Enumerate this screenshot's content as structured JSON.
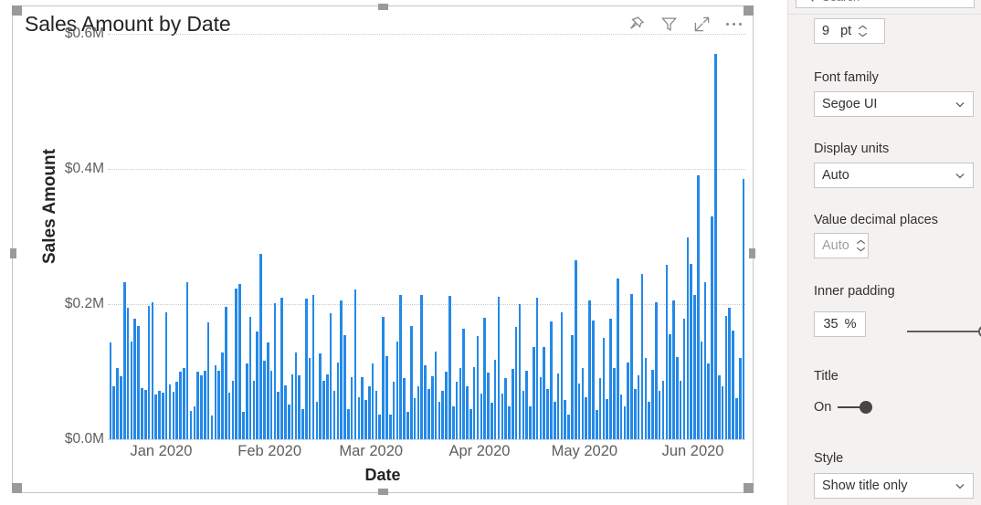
{
  "visual": {
    "title": "Sales Amount by Date",
    "header_icons": [
      {
        "name": "pin-icon",
        "label": "Pin to dashboard"
      },
      {
        "name": "filter-icon",
        "label": "Filters"
      },
      {
        "name": "focus-mode-icon",
        "label": "Focus mode"
      },
      {
        "name": "more-options-icon",
        "label": "More options"
      }
    ],
    "selected": true
  },
  "chart_data": {
    "type": "bar",
    "title": "Sales Amount by Date",
    "xlabel": "Date",
    "ylabel": "Sales Amount",
    "grid": true,
    "legend": "none",
    "ylim": [
      0,
      0.6
    ],
    "ytick_labels": [
      "$0.0M",
      "$0.2M",
      "$0.4M",
      "$0.6M"
    ],
    "ytick_values": [
      0.0,
      0.2,
      0.4,
      0.6
    ],
    "xtick_labels": [
      "Jan 2020",
      "Feb 2020",
      "Mar 2020",
      "Apr 2020",
      "May 2020",
      "Jun 2020"
    ],
    "x_start": "Jan 2020",
    "x_end": "Jun 2020",
    "series_name": "Sales Amount",
    "bar_color": "#2489e8",
    "units": "USD millions",
    "values": [
      0.143,
      0.079,
      0.105,
      0.093,
      0.232,
      0.195,
      0.145,
      0.178,
      0.167,
      0.076,
      0.073,
      0.197,
      0.203,
      0.066,
      0.071,
      0.069,
      0.188,
      0.081,
      0.07,
      0.085,
      0.1,
      0.105,
      0.232,
      0.042,
      0.048,
      0.1,
      0.094,
      0.102,
      0.173,
      0.035,
      0.109,
      0.102,
      0.129,
      0.196,
      0.069,
      0.086,
      0.223,
      0.23,
      0.041,
      0.112,
      0.181,
      0.087,
      0.159,
      0.274,
      0.116,
      0.143,
      0.102,
      0.201,
      0.07,
      0.21,
      0.08,
      0.052,
      0.096,
      0.128,
      0.095,
      0.044,
      0.208,
      0.12,
      0.214,
      0.055,
      0.127,
      0.086,
      0.096,
      0.187,
      0.071,
      0.114,
      0.205,
      0.154,
      0.045,
      0.092,
      0.221,
      0.062,
      0.092,
      0.058,
      0.079,
      0.112,
      0.072,
      0.037,
      0.181,
      0.123,
      0.036,
      0.085,
      0.144,
      0.213,
      0.09,
      0.04,
      0.168,
      0.061,
      0.078,
      0.214,
      0.11,
      0.075,
      0.093,
      0.13,
      0.055,
      0.072,
      0.1,
      0.212,
      0.048,
      0.085,
      0.105,
      0.163,
      0.078,
      0.044,
      0.107,
      0.153,
      0.068,
      0.18,
      0.098,
      0.054,
      0.118,
      0.211,
      0.067,
      0.09,
      0.049,
      0.104,
      0.166,
      0.2,
      0.071,
      0.101,
      0.048,
      0.137,
      0.21,
      0.092,
      0.136,
      0.075,
      0.174,
      0.056,
      0.097,
      0.188,
      0.058,
      0.036,
      0.154,
      0.265,
      0.083,
      0.105,
      0.062,
      0.205,
      0.176,
      0.043,
      0.091,
      0.15,
      0.06,
      0.178,
      0.106,
      0.238,
      0.066,
      0.049,
      0.113,
      0.215,
      0.075,
      0.094,
      0.245,
      0.12,
      0.055,
      0.103,
      0.203,
      0.072,
      0.086,
      0.258,
      0.155,
      0.206,
      0.121,
      0.087,
      0.179,
      0.298,
      0.26,
      0.213,
      0.39,
      0.145,
      0.233,
      0.112,
      0.33,
      0.57,
      0.095,
      0.079,
      0.182,
      0.195,
      0.161,
      0.061,
      0.12,
      0.385
    ]
  },
  "pane": {
    "search": {
      "placeholder": "Search",
      "value": ""
    },
    "font_size": {
      "value": "9",
      "unit": "pt"
    },
    "font_family": {
      "label": "Font family",
      "value": "Segoe UI"
    },
    "display_units": {
      "label": "Display units",
      "value": "Auto"
    },
    "value_decimal_places": {
      "label": "Value decimal places",
      "value": "Auto"
    },
    "inner_padding": {
      "label": "Inner padding",
      "value": "35",
      "unit": "%"
    },
    "title": {
      "label": "Title",
      "state": "On"
    },
    "style": {
      "label": "Style",
      "value": "Show title only"
    }
  }
}
